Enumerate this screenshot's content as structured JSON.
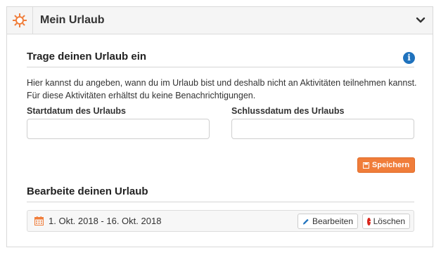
{
  "panel": {
    "title": "Mein Urlaub",
    "icon": "sun-icon",
    "collapse_icon": "chevron-down-icon",
    "accent_color": "#f07d3a"
  },
  "form": {
    "title": "Trage deinen Urlaub ein",
    "info_icon": "info-icon",
    "description": "Hier kannst du angeben, wann du im Urlaub bist und deshalb nicht an Aktivitäten teilnehmen kannst. Für diese Aktivitäten erhältst du keine Benachrichtigungen.",
    "start_label": "Startdatum des Urlaubs",
    "start_value": "",
    "end_label": "Schlussdatum des Urlaubs",
    "end_value": "",
    "save_label": "Speichern"
  },
  "edit_section": {
    "title": "Bearbeite deinen Urlaub",
    "entries": [
      {
        "dates": "1. Okt. 2018 - 16. Okt. 2018",
        "edit_label": "Bearbeiten",
        "delete_label": "Löschen"
      }
    ]
  }
}
